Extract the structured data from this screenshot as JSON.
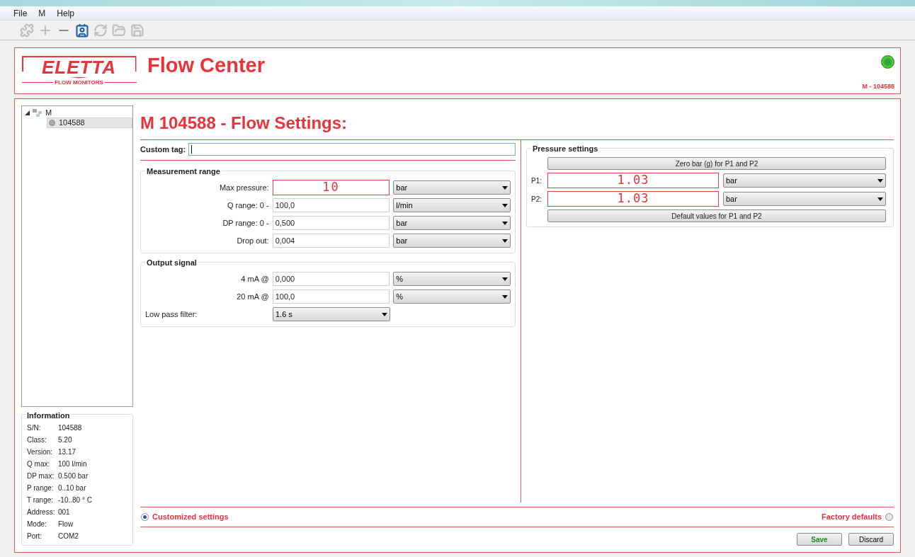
{
  "menu": [
    {
      "label": "File"
    },
    {
      "label": "M"
    },
    {
      "label": "Help"
    }
  ],
  "toolbar": [
    {
      "kind": "puzzle",
      "disabled": true
    },
    {
      "kind": "plus",
      "disabled": true
    },
    {
      "kind": "minus",
      "disabled": false
    },
    {
      "kind": "id-card",
      "disabled": false
    },
    {
      "kind": "refresh",
      "disabled": true
    },
    {
      "kind": "folder",
      "disabled": true
    },
    {
      "kind": "save",
      "disabled": true
    }
  ],
  "header": {
    "logo": {
      "name": "ELETTA",
      "tagline": "FLOW MONITORS"
    },
    "title": "Flow Center",
    "status": {
      "on": true
    },
    "device": "M - 104588"
  },
  "tree": [
    {
      "label": "M",
      "expanded": true,
      "children": [
        {
          "label": "104588",
          "selected": true
        }
      ]
    }
  ],
  "information": {
    "title": "Information",
    "rows": [
      {
        "label": "S/N:",
        "value": "104588"
      },
      {
        "label": "Class:",
        "value": "5.20"
      },
      {
        "label": "Version:",
        "value": "13.17"
      },
      {
        "label": "Q max:",
        "value": "100 l/min"
      },
      {
        "label": "DP max:",
        "value": "0.500 bar"
      },
      {
        "label": "P range:",
        "value": "0..10 bar"
      },
      {
        "label": "T range:",
        "value": "-10..80 ° C"
      },
      {
        "label": "Address:",
        "value": "001"
      },
      {
        "label": "Mode:",
        "value": "Flow"
      },
      {
        "label": "Port:",
        "value": "COM2"
      }
    ]
  },
  "settings_title": "M 104588 - Flow Settings:",
  "custom_tag": {
    "label": "Custom tag:",
    "focused": true
  },
  "measurement_range": {
    "title": "Measurement range",
    "rows": [
      {
        "kind": "display",
        "label": "Max pressure:",
        "value": "10",
        "unit": "bar"
      },
      {
        "kind": "input",
        "label": "Q range: 0 -",
        "value": "100,0",
        "unit": "l/min"
      },
      {
        "kind": "input",
        "label": "DP range: 0 -",
        "value": "0,500",
        "unit": "bar"
      },
      {
        "kind": "input",
        "label": "Drop out:",
        "value": "0,004",
        "unit": "bar"
      }
    ]
  },
  "output_signal": {
    "title": "Output signal",
    "rows": [
      {
        "kind": "input",
        "label": "4 mA @",
        "value": "0,000",
        "unit": "%"
      },
      {
        "kind": "input",
        "label": "20 mA @",
        "value": "100,0",
        "unit": "%"
      },
      {
        "kind": "select",
        "label": "Low pass filter:",
        "value": "1.6 s"
      }
    ]
  },
  "pressure_settings": {
    "title": "Pressure settings",
    "zero_button": "Zero bar (g) for P1 and P2",
    "rows": [
      {
        "label": "P1:",
        "value": "1.03",
        "unit": "bar"
      },
      {
        "label": "P2:",
        "value": "1.03",
        "unit": "bar"
      }
    ],
    "default_button": "Default values for P1 and P2"
  },
  "mode": [
    {
      "label": "Customized settings",
      "selected": true
    },
    {
      "label": "Factory defaults",
      "selected": false
    }
  ],
  "actions": [
    {
      "label": "Save",
      "kind": "primary"
    },
    {
      "label": "Discard",
      "kind": "secondary"
    }
  ]
}
